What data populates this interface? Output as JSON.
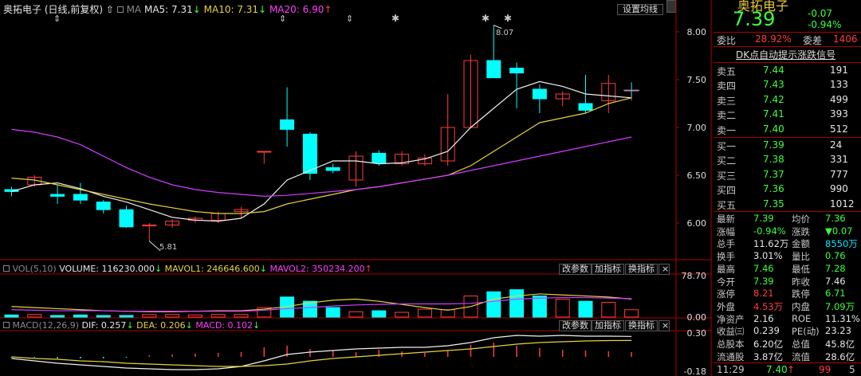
{
  "main": {
    "stock": "奥拓电子",
    "period": "(日线,前复权)",
    "icons": [
      "up-arrow-icon",
      "square-icon"
    ],
    "ma_label": "MA",
    "ma5": "MA5: 7.31",
    "ma5_arrow": "↓",
    "ma10": "MA10: 7.31",
    "ma10_arrow": "↓",
    "ma20": "MA20: 6.90",
    "ma20_arrow": "↑",
    "setting_btn": "设置均线",
    "high_mark": "8.07",
    "low_mark": "5.81",
    "axis": [
      "8.00",
      "7.50",
      "7.00",
      "6.50",
      "6.00"
    ]
  },
  "vol": {
    "label": "VOL(5,10)",
    "volume": "VOLUME: 116230.000",
    "vol_arrow": "↓",
    "mavol1": "MAVOL1: 246646.600",
    "mavol1_arrow": "↓",
    "mavol2": "MAVOL2: 350234.200",
    "mavol2_arrow": "↑",
    "btn1": "改参数",
    "btn2": "加指标",
    "btn3": "换指标",
    "close": "×",
    "axis_top": "78.70",
    "axis_bot": "0.00"
  },
  "macd": {
    "label": "MACD(12,26,9)",
    "dif": "DIF: 0.257",
    "dif_arrow": "↓",
    "dea": "DEA: 0.206",
    "dea_arrow": "↓",
    "macd": "MACD: 0.102",
    "macd_arrow": "↓",
    "btn1": "改参数",
    "btn2": "加指标",
    "btn3": "换指标",
    "close": "×",
    "axis_top": "0.30",
    "axis_bot": "-0.18"
  },
  "panel": {
    "title": "奥拓电子",
    "price": "7.39",
    "change": "-0.07",
    "pct": "-0.94%",
    "wb_label": "委比",
    "wb": "28.92%",
    "wc_label": "委差",
    "wc": "1406",
    "hint": "DK点自动提示涨跌信号",
    "asks": [
      {
        "l": "卖五",
        "p": "7.44",
        "v": "191"
      },
      {
        "l": "卖四",
        "p": "7.43",
        "v": "133"
      },
      {
        "l": "卖三",
        "p": "7.42",
        "v": "499"
      },
      {
        "l": "卖二",
        "p": "7.41",
        "v": "393"
      },
      {
        "l": "卖一",
        "p": "7.40",
        "v": "512"
      }
    ],
    "bids": [
      {
        "l": "买一",
        "p": "7.39",
        "v": "24"
      },
      {
        "l": "买二",
        "p": "7.38",
        "v": "331"
      },
      {
        "l": "买三",
        "p": "7.37",
        "v": "777"
      },
      {
        "l": "买四",
        "p": "7.36",
        "v": "990"
      },
      {
        "l": "买五",
        "p": "7.35",
        "v": "1012"
      }
    ],
    "stats": [
      {
        "l1": "最新",
        "v1": "7.39",
        "c1": "grn",
        "l2": "均价",
        "v2": "7.36",
        "c2": "grn"
      },
      {
        "l1": "涨幅",
        "v1": "-0.94%",
        "c1": "grn",
        "l2": "涨跌",
        "v2": "▼0.07",
        "c2": "grn"
      },
      {
        "l1": "总手",
        "v1": "11.62万",
        "c1": "wht",
        "l2": "金额",
        "v2": "8550万",
        "c2": "cyn"
      },
      {
        "l1": "换手",
        "v1": "3.01%",
        "c1": "wht",
        "l2": "量比",
        "v2": "0.76",
        "c2": "grn"
      },
      {
        "l1": "最高",
        "v1": "7.46",
        "c1": "grn",
        "l2": "最低",
        "v2": "7.28",
        "c2": "grn"
      },
      {
        "l1": "今开",
        "v1": "7.39",
        "c1": "grn",
        "l2": "昨收",
        "v2": "7.46",
        "c2": "wht"
      },
      {
        "l1": "涨停",
        "v1": "8.21",
        "c1": "red",
        "l2": "跌停",
        "v2": "6.71",
        "c2": "grn"
      },
      {
        "l1": "外盘",
        "v1": "4.53万",
        "c1": "red",
        "l2": "内盘",
        "v2": "7.09万",
        "c2": "grn"
      },
      {
        "l1": "净资产",
        "v1": "2.16",
        "c1": "wht",
        "l2": "ROE",
        "v2": "11.31%",
        "c2": "wht"
      },
      {
        "l1": "收益㈢",
        "v1": "0.239",
        "c1": "wht",
        "l2": "PE(动)",
        "v2": "23.23",
        "c2": "wht"
      },
      {
        "l1": "总股本",
        "v1": "6.20亿",
        "c1": "wht",
        "l2": "总值",
        "v2": "45.8亿",
        "c2": "wht"
      },
      {
        "l1": "流通股",
        "v1": "3.87亿",
        "c1": "wht",
        "l2": "流值",
        "v2": "28.6亿",
        "c2": "wht"
      }
    ],
    "time": "11:29",
    "last": "7.40",
    "last_arrow": "↑",
    "tick_vol": "99",
    "tick_n": "5"
  },
  "chart_data": [
    {
      "type": "candlestick",
      "ylim": [
        5.7,
        8.15
      ],
      "candles": [
        {
          "o": 6.35,
          "h": 6.38,
          "l": 6.28,
          "c": 6.33
        },
        {
          "o": 6.4,
          "h": 6.5,
          "l": 6.38,
          "c": 6.48
        },
        {
          "o": 6.3,
          "h": 6.4,
          "l": 6.2,
          "c": 6.28
        },
        {
          "o": 6.3,
          "h": 6.42,
          "l": 6.2,
          "c": 6.24
        },
        {
          "o": 6.22,
          "h": 6.24,
          "l": 6.1,
          "c": 6.14
        },
        {
          "o": 6.14,
          "h": 6.18,
          "l": 5.95,
          "c": 5.96
        },
        {
          "o": 5.97,
          "h": 6.0,
          "l": 5.81,
          "c": 5.98
        },
        {
          "o": 5.98,
          "h": 6.04,
          "l": 5.95,
          "c": 6.02
        },
        {
          "o": 6.03,
          "h": 6.07,
          "l": 6.0,
          "c": 6.05
        },
        {
          "o": 6.03,
          "h": 6.12,
          "l": 6.0,
          "c": 6.1
        },
        {
          "o": 6.12,
          "h": 6.17,
          "l": 6.05,
          "c": 6.14
        },
        {
          "o": 6.75,
          "h": 6.75,
          "l": 6.62,
          "c": 6.75
        },
        {
          "o": 7.08,
          "h": 7.42,
          "l": 6.8,
          "c": 6.98
        },
        {
          "o": 6.93,
          "h": 6.95,
          "l": 6.45,
          "c": 6.52
        },
        {
          "o": 6.58,
          "h": 6.62,
          "l": 6.52,
          "c": 6.55
        },
        {
          "o": 6.45,
          "h": 6.75,
          "l": 6.38,
          "c": 6.7
        },
        {
          "o": 6.73,
          "h": 6.76,
          "l": 6.6,
          "c": 6.63
        },
        {
          "o": 6.62,
          "h": 6.75,
          "l": 6.6,
          "c": 6.72
        },
        {
          "o": 6.62,
          "h": 6.72,
          "l": 6.6,
          "c": 6.68
        },
        {
          "o": 6.65,
          "h": 7.35,
          "l": 6.6,
          "c": 7.0
        },
        {
          "o": 7.0,
          "h": 7.76,
          "l": 7.0,
          "c": 7.7
        },
        {
          "o": 7.7,
          "h": 8.07,
          "l": 7.55,
          "c": 7.52
        },
        {
          "o": 7.62,
          "h": 7.68,
          "l": 7.2,
          "c": 7.57
        },
        {
          "o": 7.4,
          "h": 7.45,
          "l": 7.15,
          "c": 7.3
        },
        {
          "o": 7.3,
          "h": 7.38,
          "l": 7.22,
          "c": 7.35
        },
        {
          "o": 7.25,
          "h": 7.55,
          "l": 7.15,
          "c": 7.18
        },
        {
          "o": 7.28,
          "h": 7.55,
          "l": 7.15,
          "c": 7.46
        },
        {
          "o": 7.39,
          "h": 7.46,
          "l": 7.28,
          "c": 7.39
        }
      ],
      "ma5": [
        6.33,
        6.4,
        6.42,
        6.36,
        6.28,
        6.22,
        6.14,
        6.06,
        6.03,
        6.02,
        6.05,
        6.2,
        6.45,
        6.55,
        6.65,
        6.65,
        6.62,
        6.63,
        6.67,
        6.75,
        7.0,
        7.2,
        7.4,
        7.48,
        7.43,
        7.35,
        7.33,
        7.31
      ],
      "ma10": [
        6.47,
        6.45,
        6.4,
        6.35,
        6.3,
        6.25,
        6.2,
        6.16,
        6.12,
        6.1,
        6.1,
        6.12,
        6.2,
        6.25,
        6.3,
        6.35,
        6.38,
        6.42,
        6.46,
        6.5,
        6.6,
        6.75,
        6.9,
        7.05,
        7.1,
        7.15,
        7.25,
        7.31
      ],
      "ma20": [
        6.98,
        6.95,
        6.9,
        6.82,
        6.7,
        6.58,
        6.48,
        6.4,
        6.35,
        6.32,
        6.3,
        6.28,
        6.29,
        6.31,
        6.33,
        6.35,
        6.38,
        6.42,
        6.46,
        6.5,
        6.55,
        6.6,
        6.65,
        6.7,
        6.75,
        6.8,
        6.85,
        6.9
      ]
    },
    {
      "type": "bar",
      "ylim": [
        0,
        78.7
      ],
      "values": [
        4,
        5,
        3,
        4,
        3,
        3,
        5,
        5,
        4,
        5,
        5,
        18,
        38,
        30,
        18,
        10,
        12,
        9,
        15,
        14,
        40,
        48,
        52,
        40,
        34,
        30,
        28,
        14
      ],
      "mavol1": [
        20,
        18,
        16,
        14,
        12,
        11,
        10,
        10,
        11,
        12,
        12,
        15,
        20,
        27,
        32,
        34,
        30,
        24,
        18,
        13,
        20,
        34,
        40,
        44,
        42,
        40,
        38,
        34
      ],
      "mavol2": [
        14,
        13,
        12,
        12,
        12,
        11,
        11,
        11,
        11,
        11,
        11,
        13,
        16,
        18,
        21,
        23,
        24,
        25,
        25,
        25,
        26,
        30,
        34,
        36,
        37,
        37,
        36,
        35
      ]
    },
    {
      "type": "bar",
      "ylim": [
        -0.18,
        0.3
      ],
      "values": [
        -0.01,
        -0.01,
        -0.02,
        -0.02,
        -0.02,
        -0.01,
        0.02,
        0.03,
        0.04,
        0.05,
        0.06,
        0.12,
        0.14,
        0.1,
        0.08,
        0.06,
        0.09,
        0.07,
        0.05,
        0.08,
        0.15,
        0.18,
        0.14,
        0.11,
        0.09,
        0.08,
        0.07,
        0.06
      ],
      "dif": [
        -0.02,
        -0.05,
        -0.08,
        -0.1,
        -0.12,
        -0.14,
        -0.15,
        -0.16,
        -0.16,
        -0.15,
        -0.12,
        -0.05,
        0.03,
        0.06,
        0.08,
        0.1,
        0.11,
        0.12,
        0.12,
        0.14,
        0.18,
        0.24,
        0.27,
        0.26,
        0.27,
        0.26,
        0.26,
        0.257
      ],
      "dea": [
        0.0,
        -0.02,
        -0.03,
        -0.05,
        -0.06,
        -0.08,
        -0.09,
        -0.1,
        -0.11,
        -0.12,
        -0.12,
        -0.11,
        -0.09,
        -0.05,
        -0.02,
        0.0,
        0.02,
        0.04,
        0.06,
        0.08,
        0.1,
        0.13,
        0.16,
        0.18,
        0.19,
        0.2,
        0.205,
        0.206
      ]
    }
  ]
}
